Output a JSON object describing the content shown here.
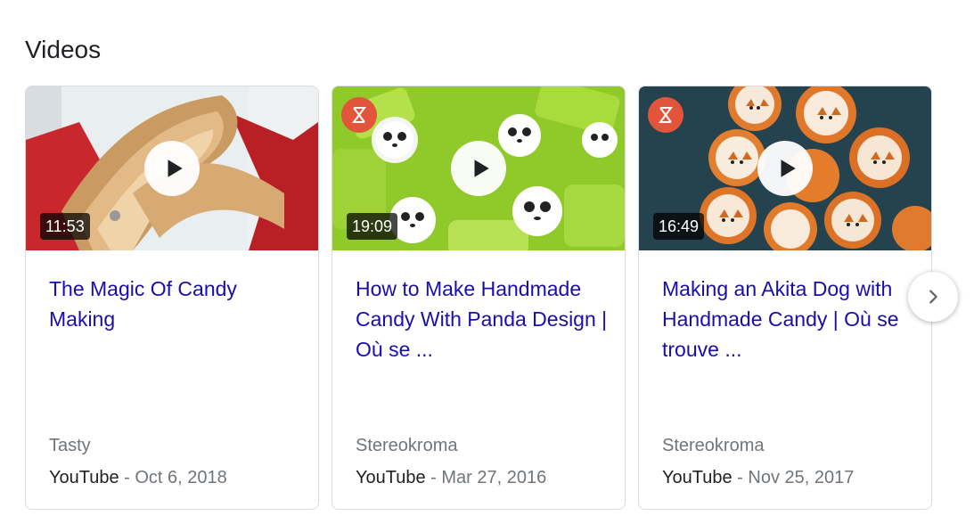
{
  "section": {
    "title": "Videos"
  },
  "cards": [
    {
      "duration": "11:53",
      "title": "The Magic Of Candy Making",
      "source": "Tasty",
      "platform": "YouTube",
      "separator": " - ",
      "date": "Oct 6, 2018",
      "has_channel_logo": false
    },
    {
      "duration": "19:09",
      "title": "How to Make Handmade Candy With Panda Design | Où se ...",
      "source": "Stereokroma",
      "platform": "YouTube",
      "separator": " - ",
      "date": "Mar 27, 2016",
      "has_channel_logo": true
    },
    {
      "duration": "16:49",
      "title": "Making an Akita Dog with Handmade Candy | Où se trouve ...",
      "source": "Stereokroma",
      "platform": "YouTube",
      "separator": " - ",
      "date": "Nov 25, 2017",
      "has_channel_logo": true
    }
  ],
  "icons": {
    "play": "play-icon",
    "next": "chevron-right-icon",
    "channel_logo": "stereokroma-logo-icon"
  },
  "colors": {
    "link": "#1a0dab",
    "secondary_text": "#70757a",
    "primary_text": "#202124",
    "border": "#dadce0",
    "logo": "#e2553a"
  }
}
